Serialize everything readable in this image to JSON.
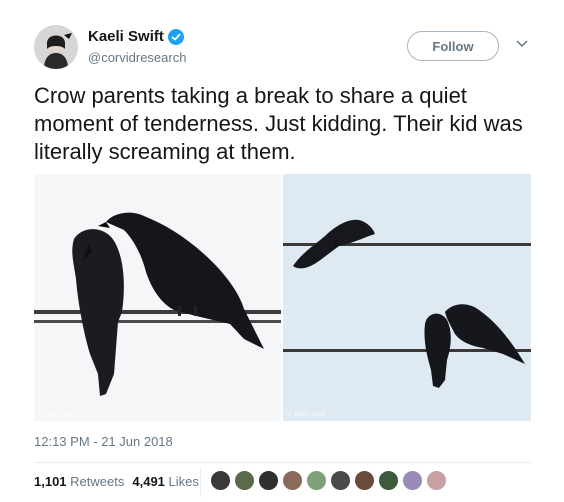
{
  "author": {
    "name": "Kaeli Swift",
    "handle": "@corvidresearch",
    "verified": true,
    "avatar_icon": "user-avatar"
  },
  "follow_label": "Follow",
  "tweet_text": "Crow parents taking a break to share a quiet moment of tenderness. Just kidding. Their kid was literally screaming at them.",
  "media": {
    "left_watermark": "© Kaeli Swift",
    "right_watermark": "© Kaeli Swift"
  },
  "timestamp": "12:13 PM - 21 Jun 2018",
  "stats": {
    "retweets_count": "1,101",
    "retweets_label": "Retweets",
    "likes_count": "4,491",
    "likes_label": "Likes"
  },
  "likers": [
    {
      "color": "#3a3a3a"
    },
    {
      "color": "#5a6a4a"
    },
    {
      "color": "#2f2f2f"
    },
    {
      "color": "#8a6a5a"
    },
    {
      "color": "#7fa07a"
    },
    {
      "color": "#4a4a4a"
    },
    {
      "color": "#6a4a3a"
    },
    {
      "color": "#3d5a3d"
    },
    {
      "color": "#9a8ab8"
    },
    {
      "color": "#c8a0a0"
    }
  ],
  "colors": {
    "verified": "#1da1f2",
    "secondary_text": "#657786",
    "primary_text": "#14171a"
  }
}
